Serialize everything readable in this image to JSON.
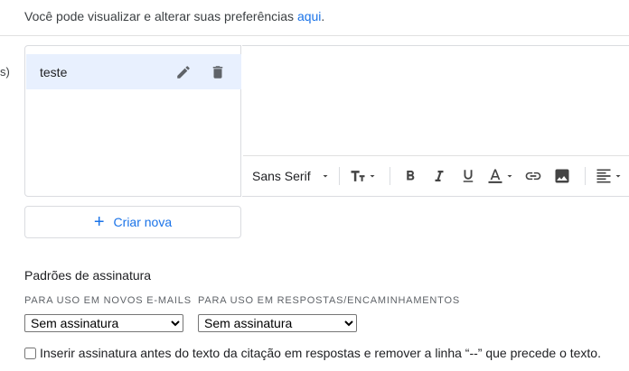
{
  "preferences": {
    "text": "Você pode visualizar e alterar suas preferências ",
    "link": "aqui",
    "period": "."
  },
  "left_edge_text": "s)",
  "signatures": {
    "items": [
      {
        "name": "teste",
        "edit_icon": "pencil-icon",
        "delete_icon": "trash-icon"
      }
    ],
    "create_label": "Criar nova"
  },
  "toolbar": {
    "font": "Sans Serif",
    "buttons": [
      "text-size",
      "bold",
      "italic",
      "underline",
      "text-color",
      "link",
      "image",
      "align"
    ]
  },
  "defaults": {
    "title": "Padrões de assinatura",
    "new_emails_label": "PARA USO EM NOVOS E-MAILS",
    "new_emails_value": "Sem assinatura",
    "replies_label": "PARA USO EM RESPOSTAS/ENCAMINHAMENTOS",
    "replies_value": "Sem assinatura",
    "insert_before_quote": "Inserir assinatura antes do texto da citação em respostas e remover a linha “--” que precede o texto.",
    "insert_before_quote_checked": false
  },
  "colors": {
    "accent": "#1a73e8",
    "selected_bg": "#e8f0fe",
    "border": "#dadce0",
    "icon": "#5f6368"
  }
}
